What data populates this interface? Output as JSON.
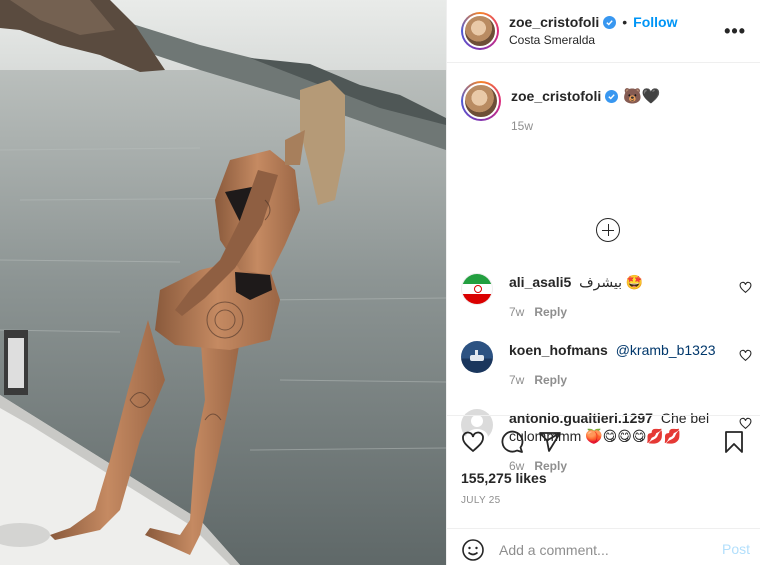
{
  "header": {
    "username": "zoe_cristofoli",
    "verified": true,
    "separator": "•",
    "follow_label": "Follow",
    "location": "Costa Smeralda",
    "more_label": "•••"
  },
  "caption": {
    "username": "zoe_cristofoli",
    "emoji": "🐻🖤",
    "time": "15w"
  },
  "comments": [
    {
      "username": "ali_asali5",
      "text": "بیشرف 🤩",
      "mention": "",
      "time": "7w",
      "reply_label": "Reply",
      "avatar": "iran-flag"
    },
    {
      "username": "koen_hofmans",
      "text": "",
      "mention": "@kramb_b1323",
      "time": "7w",
      "reply_label": "Reply",
      "avatar": "boat-photo"
    },
    {
      "username": "antonio.gualtieri.1297",
      "text": "Che bel culommmm 🍑😋😋😋💋💋",
      "mention": "",
      "time": "6w",
      "reply_label": "Reply",
      "avatar": "default-person"
    }
  ],
  "actions": {
    "likes": "155,275 likes",
    "date": "JULY 25",
    "icons": [
      "heart-icon",
      "comment-icon",
      "share-icon",
      "bookmark-icon"
    ]
  },
  "add_comment": {
    "placeholder": "Add a comment...",
    "post_label": "Post"
  },
  "colors": {
    "accent": "#0095f6",
    "verified": "#3897f0",
    "muted": "#8e8e8e",
    "post_disabled": "#b2dffc",
    "text": "#262626"
  }
}
